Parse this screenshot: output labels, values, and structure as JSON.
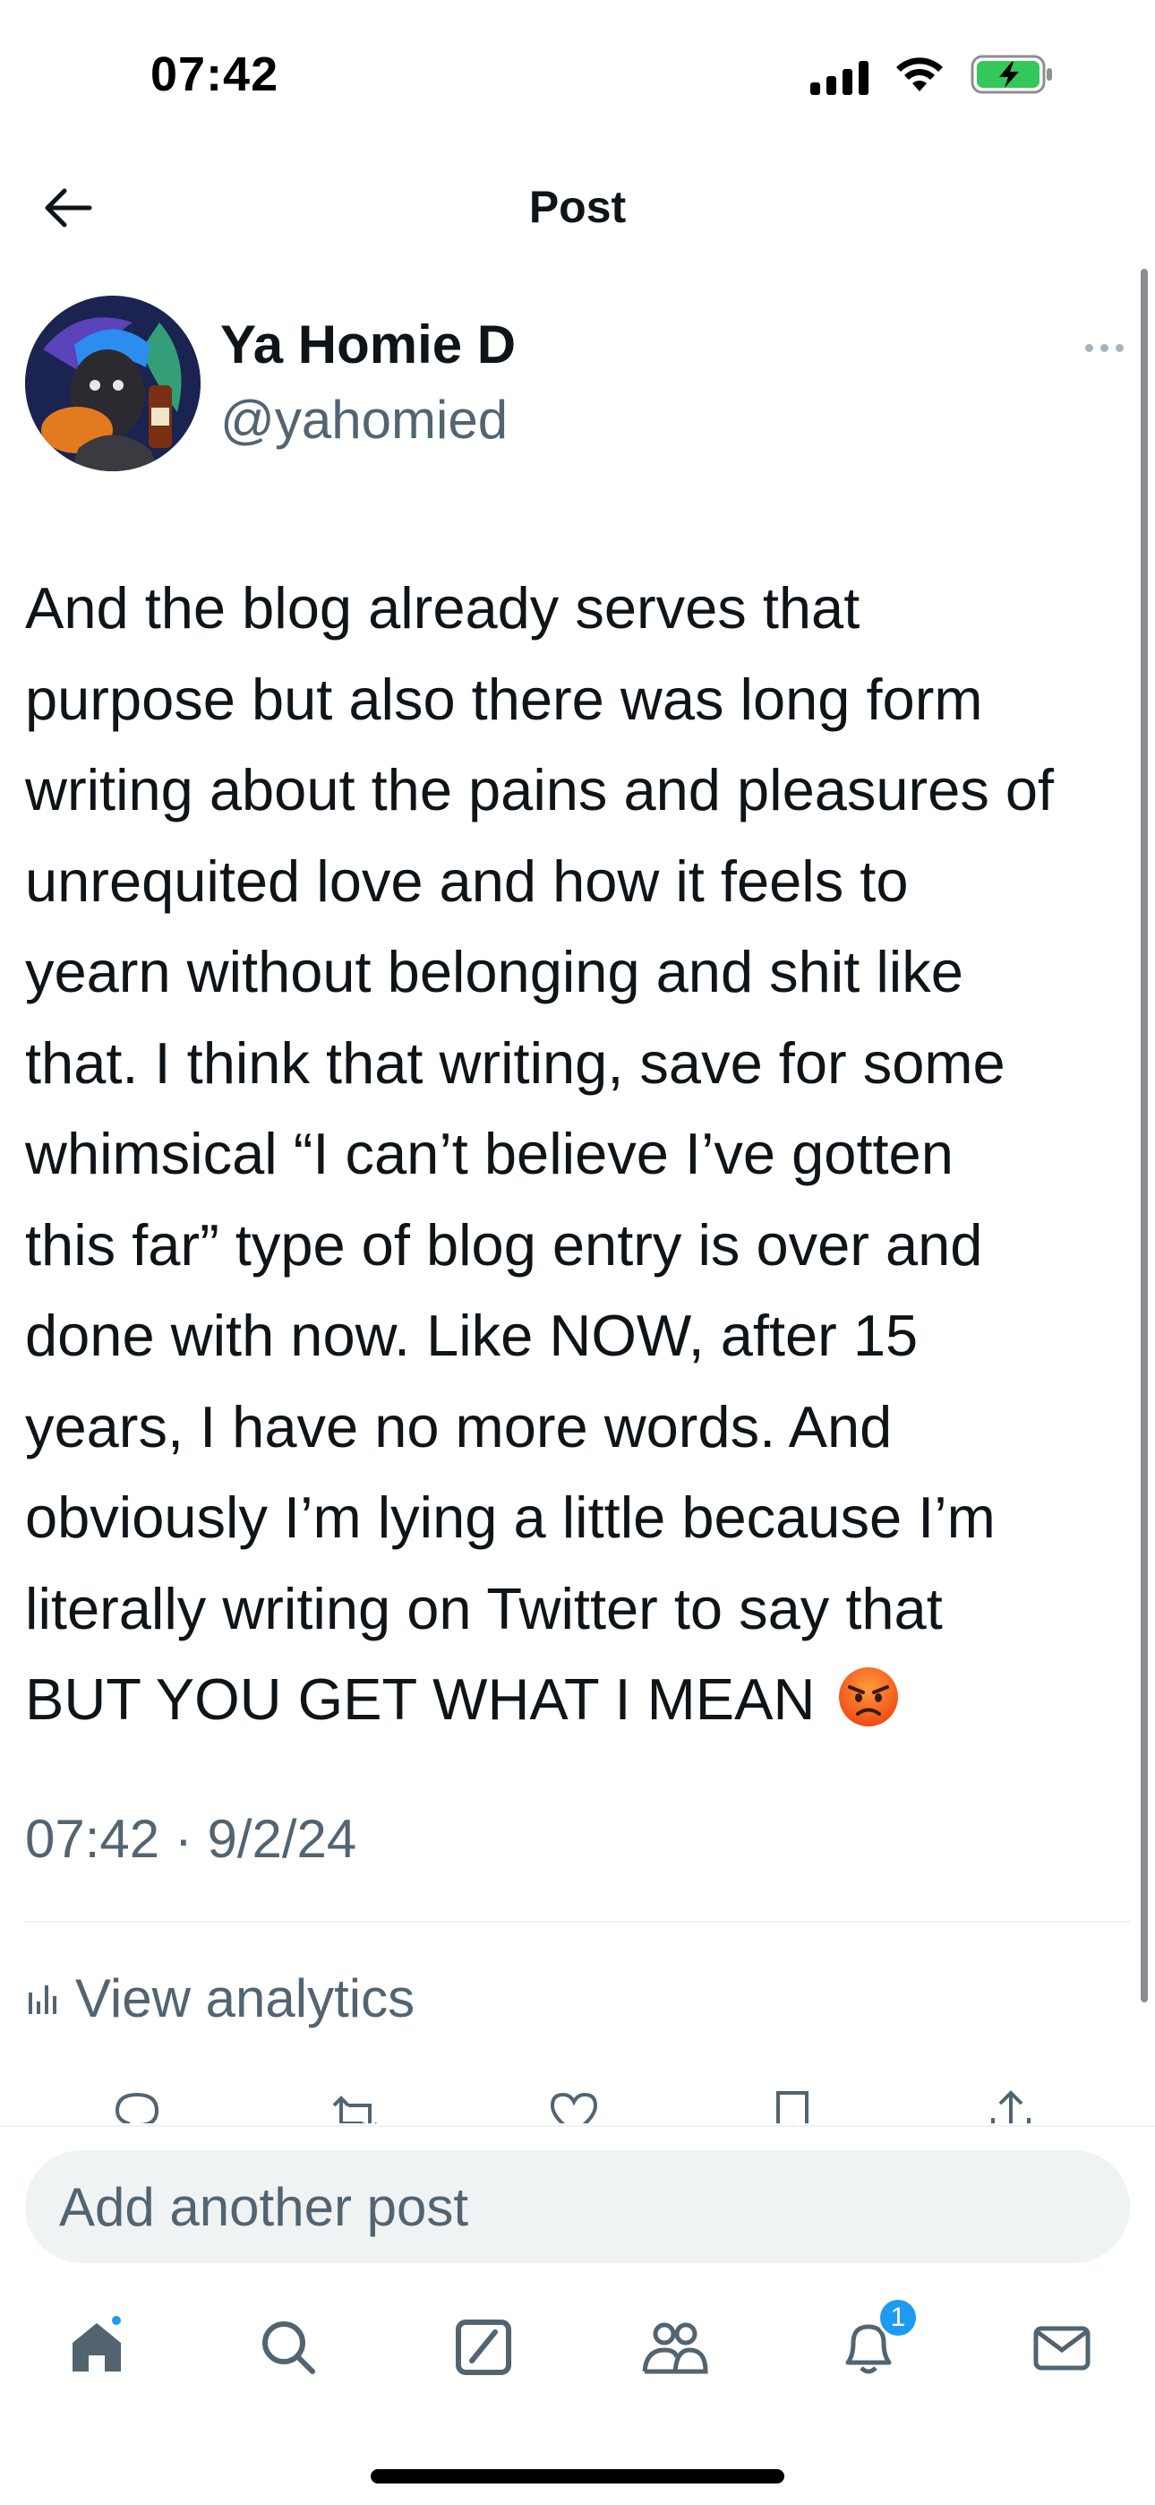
{
  "status_bar": {
    "time": "07:42",
    "icons": [
      "signal-icon",
      "wifi-icon",
      "battery-charging-icon"
    ],
    "battery_color": "#34c759"
  },
  "header": {
    "title": "Post",
    "back_icon": "arrow-left-icon"
  },
  "author": {
    "name": "Ya Homie D",
    "handle": "@yahomied",
    "more_icon": "more-horizontal-icon"
  },
  "post": {
    "lines": [
      "And the blog already serves that",
      "purpose but also there was long form",
      "writing about the pains and pleasures of",
      "unrequited love and how it feels to",
      "yearn without belonging and shit like",
      "that. I think that writing, save for some",
      "whimsical “I can’t believe I’ve gotten",
      "this far” type of blog entry is over and",
      "done with now. Like NOW, after 15",
      "years, I have no more words. And",
      "obviously I’m lying a little because I’m",
      "literally writing on Twitter to say that",
      "BUT YOU GET WHAT I MEAN"
    ],
    "emoji_icon": "angry-face-emoji",
    "timestamp": "07:42 · 9/2/24"
  },
  "analytics": {
    "label": "View analytics",
    "icon": "analytics-bars-icon"
  },
  "actions": [
    {
      "name": "reply",
      "icon": "reply-icon"
    },
    {
      "name": "repost",
      "icon": "repost-icon"
    },
    {
      "name": "like",
      "icon": "heart-icon"
    },
    {
      "name": "bookmark",
      "icon": "bookmark-icon"
    },
    {
      "name": "share",
      "icon": "share-icon"
    }
  ],
  "compose": {
    "placeholder": "Add another post"
  },
  "tabbar": {
    "items": [
      {
        "name": "home",
        "icon": "home-icon",
        "has_dot": true
      },
      {
        "name": "search",
        "icon": "search-icon"
      },
      {
        "name": "grok",
        "icon": "grok-icon"
      },
      {
        "name": "communities",
        "icon": "communities-icon"
      },
      {
        "name": "notifications",
        "icon": "bell-icon",
        "badge": "1"
      },
      {
        "name": "messages",
        "icon": "mail-icon"
      }
    ],
    "accent_color": "#1d9bf0"
  }
}
